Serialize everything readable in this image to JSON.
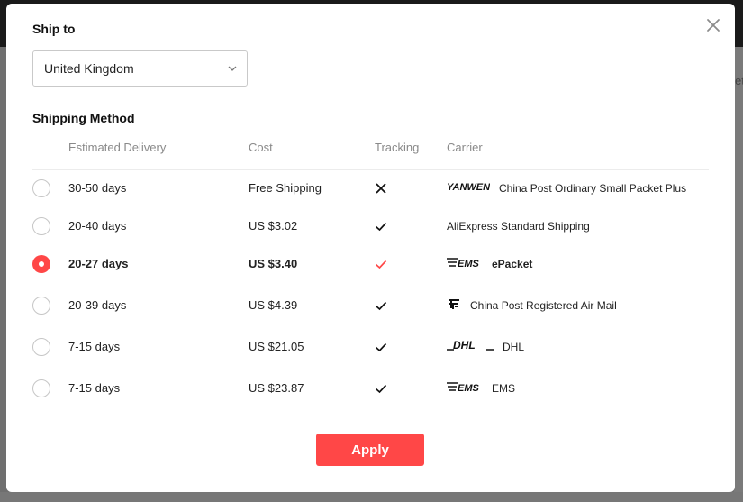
{
  "ship_to": {
    "title": "Ship to",
    "selected_country": "United Kingdom"
  },
  "shipping_method": {
    "title": "Shipping Method",
    "columns": {
      "delivery": "Estimated Delivery",
      "cost": "Cost",
      "tracking": "Tracking",
      "carrier": "Carrier"
    },
    "rows": [
      {
        "delivery": "30-50 days",
        "cost": "Free Shipping",
        "tracking": "no",
        "carrier_logo": "yanwen-logo",
        "logo_text": "YANWEN",
        "carrier": "China Post Ordinary Small Packet Plus",
        "selected": false
      },
      {
        "delivery": "20-40 days",
        "cost": "US $3.02",
        "tracking": "yes",
        "carrier_logo": "",
        "logo_text": "",
        "carrier": "AliExpress Standard Shipping",
        "selected": false
      },
      {
        "delivery": "20-27 days",
        "cost": "US $3.40",
        "tracking": "yes",
        "carrier_logo": "ems-logo",
        "logo_text": "EMS",
        "carrier": "ePacket",
        "selected": true
      },
      {
        "delivery": "20-39 days",
        "cost": "US $4.39",
        "tracking": "yes",
        "carrier_logo": "china-post-logo",
        "logo_text": "",
        "carrier": "China Post Registered Air Mail",
        "selected": false
      },
      {
        "delivery": "7-15 days",
        "cost": "US $21.05",
        "tracking": "yes",
        "carrier_logo": "dhl-logo",
        "logo_text": "DHL",
        "carrier": "DHL",
        "selected": false
      },
      {
        "delivery": "7-15 days",
        "cost": "US $23.87",
        "tracking": "yes",
        "carrier_logo": "ems-logo",
        "logo_text": "EMS",
        "carrier": "EMS",
        "selected": false
      }
    ]
  },
  "apply_label": "Apply",
  "background_peek_text": "et",
  "colors": {
    "accent": "#ff4747",
    "text": "#222222",
    "muted": "#8a8a8a"
  }
}
